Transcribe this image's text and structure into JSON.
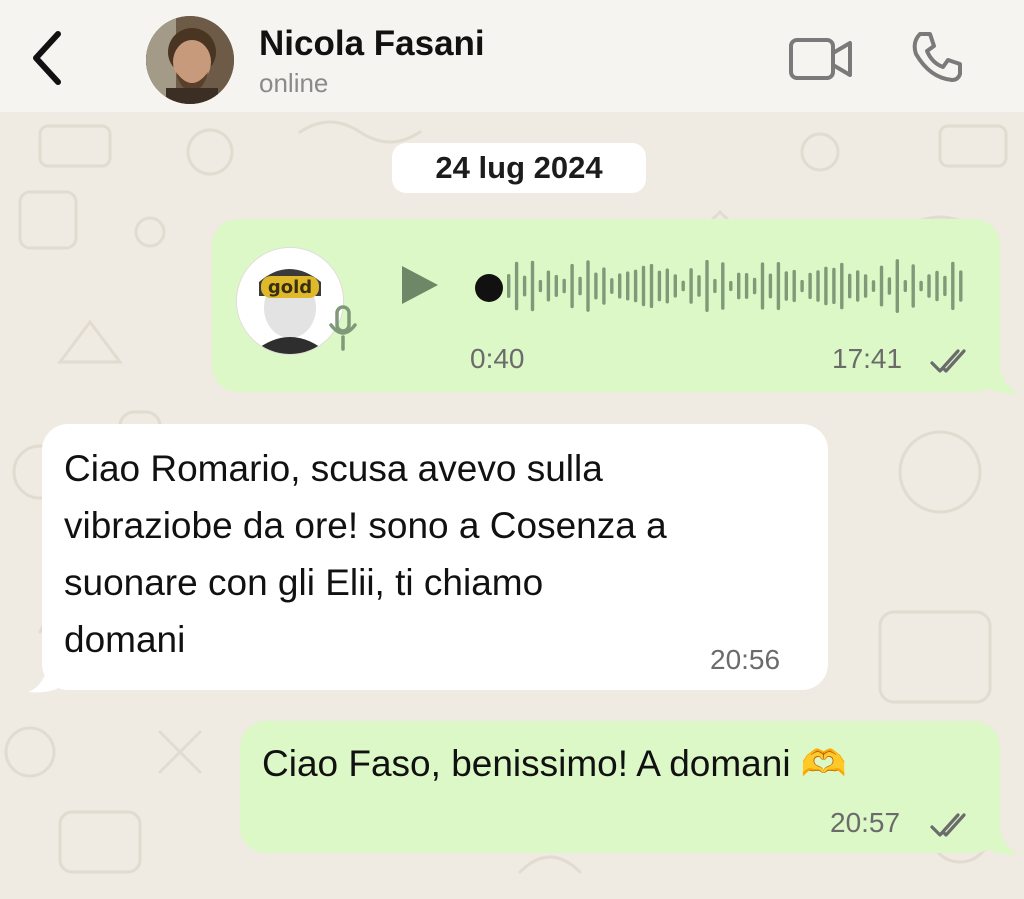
{
  "header": {
    "back_icon": "chevron-left-icon",
    "contact_name": "Nicola Fasani",
    "status": "online",
    "video_icon": "video-camera-icon",
    "call_icon": "phone-icon"
  },
  "chat": {
    "date_separator": "24 lug 2024",
    "messages": [
      {
        "type": "voice",
        "direction": "outgoing",
        "duration": "0:40",
        "time": "17:41",
        "read_icon": "double-check-icon",
        "avatar_badge": "gold"
      },
      {
        "type": "text",
        "direction": "incoming",
        "lines": [
          "Ciao Romario, scusa avevo sulla",
          "vibraziobe da ore! sono a Cosenza a",
          "suonare con gli Elii, ti chiamo",
          "domani"
        ],
        "time": "20:56"
      },
      {
        "type": "text",
        "direction": "outgoing",
        "text": "Ciao Faso, benissimo! A domani 🫶",
        "time": "20:57",
        "read_icon": "double-check-icon"
      }
    ]
  },
  "colors": {
    "outgoing_bubble": "#dcf8c6",
    "incoming_bubble": "#ffffff",
    "background": "#efeae2",
    "waveform": "#7e9a78"
  }
}
